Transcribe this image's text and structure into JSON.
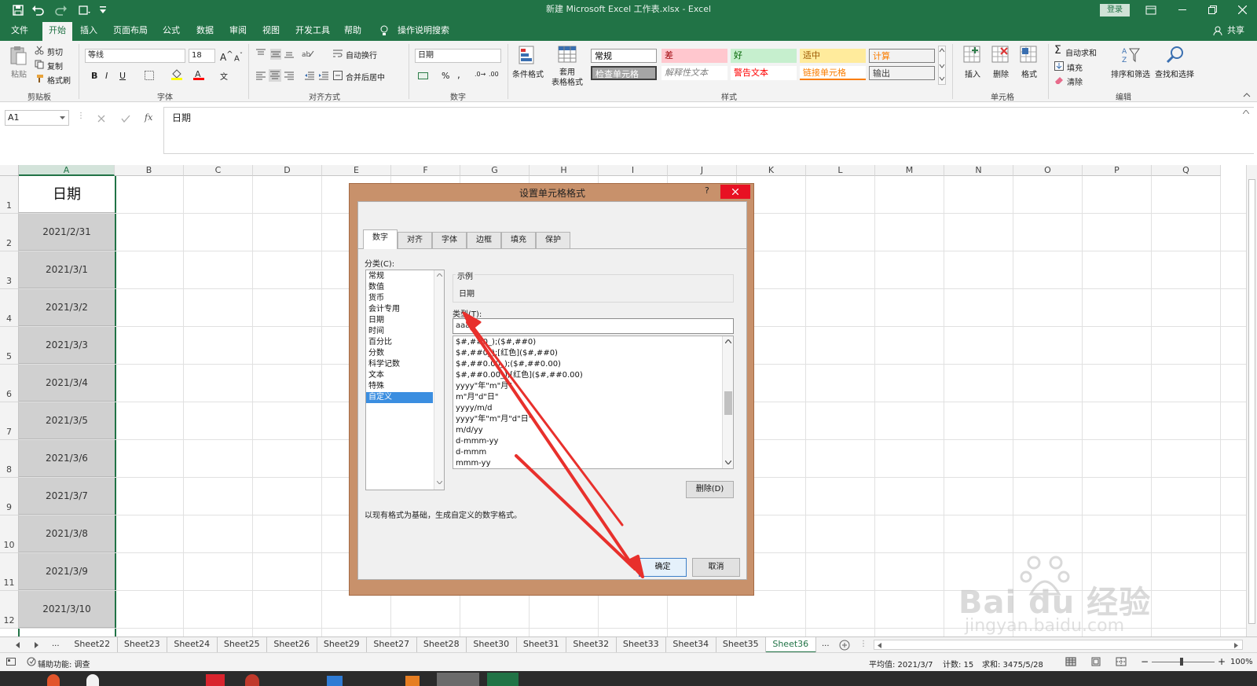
{
  "window": {
    "title": "新建 Microsoft Excel 工作表.xlsx  -  Excel",
    "login": "登录"
  },
  "ribbon_tabs": [
    "文件",
    "开始",
    "插入",
    "页面布局",
    "公式",
    "数据",
    "审阅",
    "视图",
    "开发工具",
    "帮助"
  ],
  "tell_me": "操作说明搜索",
  "share": "共享",
  "ribbon": {
    "clipboard": {
      "label": "剪贴板",
      "paste": "粘贴",
      "cut": "剪切",
      "copy": "复制",
      "format_painter": "格式刷"
    },
    "font": {
      "label": "字体",
      "name": "等线",
      "size": "18"
    },
    "alignment": {
      "label": "对齐方式",
      "wrap": "自动换行",
      "merge": "合并后居中"
    },
    "number": {
      "label": "数字",
      "format": "日期"
    },
    "styles": {
      "label": "样式",
      "conditional": "条件格式",
      "table_format": "套用\n表格格式",
      "cells": [
        {
          "text": "常规",
          "bg": "#ffffff",
          "fg": "#000000"
        },
        {
          "text": "差",
          "bg": "#ffc7ce",
          "fg": "#9c0006"
        },
        {
          "text": "好",
          "bg": "#c6efce",
          "fg": "#006100"
        },
        {
          "text": "适中",
          "bg": "#ffeb9c",
          "fg": "#9c5700"
        },
        {
          "text": "计算",
          "bg": "#f2f2f2",
          "fg": "#fa7d00"
        },
        {
          "text": "检查单元格",
          "bg": "#a5a5a5",
          "fg": "#ffffff"
        },
        {
          "text": "解释性文本",
          "bg": "#ffffff",
          "fg": "#7f7f7f"
        },
        {
          "text": "警告文本",
          "bg": "#ffffff",
          "fg": "#ff0000"
        },
        {
          "text": "链接单元格",
          "bg": "#ffffff",
          "fg": "#fa7d00"
        },
        {
          "text": "输出",
          "bg": "#f2f2f2",
          "fg": "#3f3f3f"
        }
      ]
    },
    "cells_group": {
      "label": "单元格",
      "insert": "插入",
      "delete": "删除",
      "format": "格式"
    },
    "editing": {
      "label": "编辑",
      "autosum": "自动求和",
      "fill": "填充",
      "clear": "清除",
      "sort": "排序和筛选",
      "find": "查找和选择"
    }
  },
  "formula_bar": {
    "name_box": "A1",
    "fx": "fx",
    "content": "日期"
  },
  "columns": [
    "A",
    "B",
    "C",
    "D",
    "E",
    "F",
    "G",
    "H",
    "I",
    "J",
    "K",
    "L",
    "M",
    "N",
    "O",
    "P",
    "Q"
  ],
  "rows": [
    "1",
    "2",
    "3",
    "4",
    "5",
    "6",
    "7",
    "8",
    "9",
    "10",
    "11",
    "12"
  ],
  "cells_a": [
    "日期",
    "2021/2/31",
    "2021/3/1",
    "2021/3/2",
    "2021/3/3",
    "2021/3/4",
    "2021/3/5",
    "2021/3/6",
    "2021/3/7",
    "2021/3/8",
    "2021/3/9",
    "2021/3/10"
  ],
  "sheet_tabs": [
    "Sheet22",
    "Sheet23",
    "Sheet24",
    "Sheet25",
    "Sheet26",
    "Sheet29",
    "Sheet27",
    "Sheet28",
    "Sheet30",
    "Sheet31",
    "Sheet32",
    "Sheet33",
    "Sheet34",
    "Sheet35",
    "Sheet36"
  ],
  "active_sheet": "Sheet36",
  "sheet_nav_dots": "...",
  "status": {
    "accessibility": "辅助功能: 调查",
    "average": "平均值: 2021/3/7",
    "count": "计数: 15",
    "sum": "求和: 3475/5/28",
    "zoom": "100%"
  },
  "dialog": {
    "title": "设置单元格格式",
    "help": "?",
    "tabs": [
      "数字",
      "对齐",
      "字体",
      "边框",
      "填充",
      "保护"
    ],
    "category_label": "分类(C):",
    "categories": [
      "常规",
      "数值",
      "货币",
      "会计专用",
      "日期",
      "时间",
      "百分比",
      "分数",
      "科学记数",
      "文本",
      "特殊",
      "自定义"
    ],
    "selected_category": "自定义",
    "sample_label": "示例",
    "sample_value": "日期",
    "type_label": "类型(T):",
    "type_value": "aaaa",
    "formats": [
      "$#,##0_);($#,##0)",
      "$#,##0_);[红色]($#,##0)",
      "$#,##0.00_);($#,##0.00)",
      "$#,##0.00_);[红色]($#,##0.00)",
      "yyyy\"年\"m\"月\"",
      "m\"月\"d\"日\"",
      "yyyy/m/d",
      "yyyy\"年\"m\"月\"d\"日\"",
      "m/d/yy",
      "d-mmm-yy",
      "d-mmm",
      "mmm-yy"
    ],
    "delete_button": "删除(D)",
    "description": "以现有格式为基础，生成自定义的数字格式。",
    "ok": "确定",
    "cancel": "取消"
  },
  "watermark": {
    "brand": "Bai du 经验",
    "url": "jingyan.baidu.com"
  },
  "colors": {
    "excel_green": "#217346",
    "annotation_red": "#e8302c"
  }
}
